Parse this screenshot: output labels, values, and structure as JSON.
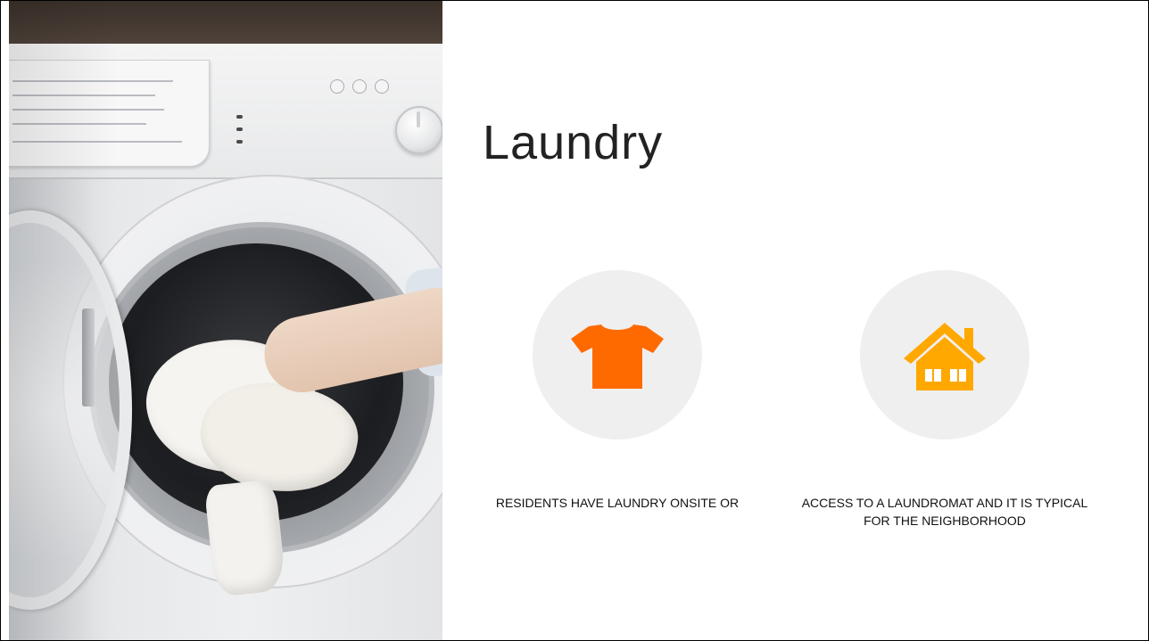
{
  "slide": {
    "title": "Laundry",
    "items": [
      {
        "icon": "tshirt-icon",
        "color": "#ff6a00",
        "caption": "RESIDENTS HAVE LAUNDRY ONSITE OR"
      },
      {
        "icon": "house-icon",
        "color": "#ffa800",
        "caption": "ACCESS TO A LAUNDROMAT AND IT IS TYPICAL FOR THE NEIGHBORHOOD"
      }
    ],
    "icon_circle_color": "#efefef"
  },
  "photo": {
    "subject": "washing-machine-photo"
  }
}
